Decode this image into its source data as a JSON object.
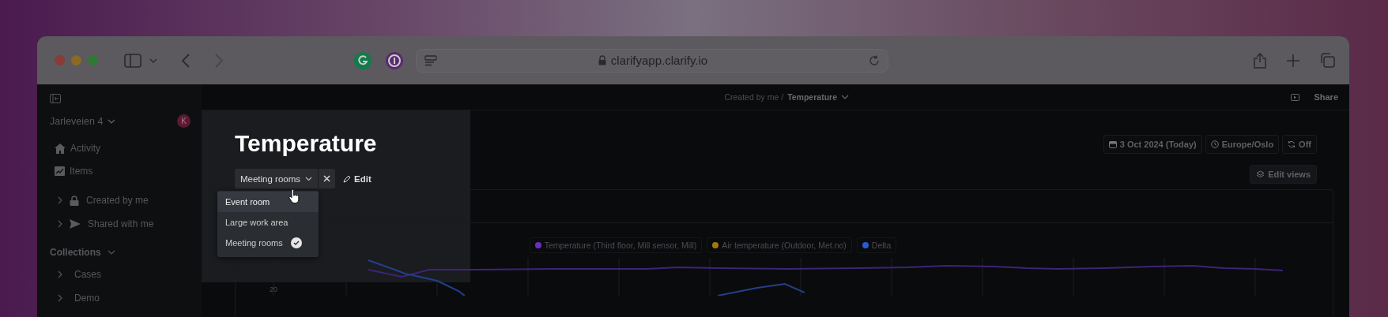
{
  "browser": {
    "address": "clarifyapp.clarify.io"
  },
  "sidebar": {
    "workspace": "Jarleveien 4",
    "avatar": "K",
    "nav": [
      {
        "label": "Activity"
      },
      {
        "label": "Items"
      }
    ],
    "folders": [
      {
        "label": "Created by me",
        "expanded": false
      },
      {
        "label": "Shared with me",
        "expanded": false
      }
    ],
    "collections": {
      "label": "Collections",
      "expanded": true,
      "items": [
        {
          "label": "Cases",
          "expanded": false
        },
        {
          "label": "Demo",
          "expanded": false
        }
      ]
    }
  },
  "breadcrumb": {
    "parent": "Created by me",
    "separator": "/",
    "current": "Temperature"
  },
  "share": "Share",
  "title": "Temperature",
  "view_select": {
    "value": "Meeting rooms",
    "options": [
      {
        "label": "Event room",
        "selected": false,
        "highlighted": true
      },
      {
        "label": "Large work area",
        "selected": false,
        "highlighted": false
      },
      {
        "label": "Meeting rooms",
        "selected": true,
        "highlighted": false
      }
    ]
  },
  "edit": "Edit",
  "controls": [
    {
      "label": "3 Oct 2024 (Today)"
    },
    {
      "label": "Europe/Oslo"
    },
    {
      "label": "Off"
    }
  ],
  "edit_views": "Edit views",
  "chart": {
    "legend": [
      {
        "label": "Temperature (Third floor, Mill sensor, Mill)",
        "color": "#6a2fc0"
      },
      {
        "label": "Air temperature (Outdoor, Met.no)",
        "color": "#a07812"
      },
      {
        "label": "Delta",
        "color": "#2a5ad0"
      }
    ],
    "y_tick": "20"
  }
}
